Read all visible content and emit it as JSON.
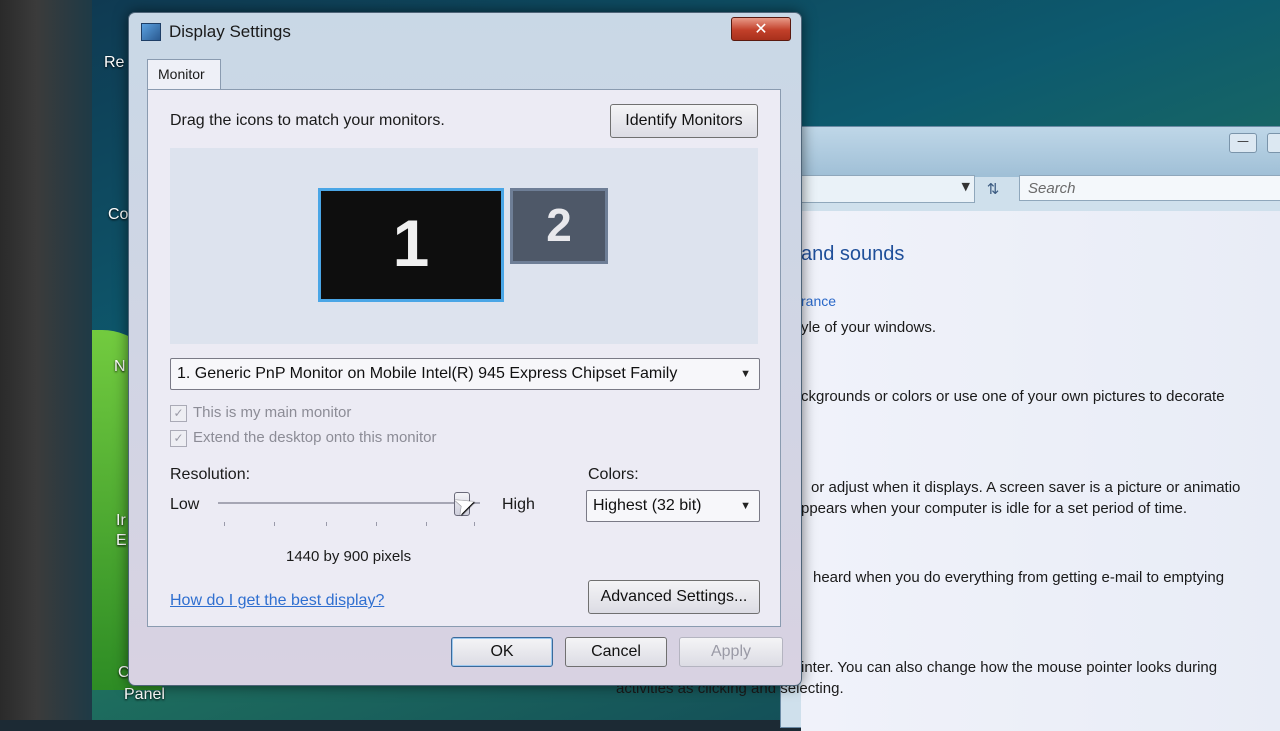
{
  "desktop": {
    "labels": [
      "Re",
      "Co",
      "N",
      "Ir",
      "E",
      "C",
      "Panel"
    ]
  },
  "background_window": {
    "search_placeholder": "Search",
    "heading": "and sounds",
    "link": "rance",
    "lines": [
      "yle of your windows.",
      "ckgrounds or colors or use one of your own pictures to decorate",
      "or adjust when it displays. A screen saver is a picture or animatio",
      "ppears when your computer is idle for a set period of time.",
      "heard when you do everything from getting e-mail to emptying",
      "inter. You can also change how the mouse pointer looks during",
      "activities as clicking and selecting."
    ],
    "minimize_label": "—"
  },
  "dialog": {
    "title": "Display Settings",
    "close_label": "✕",
    "tab": "Monitor",
    "instruction": "Drag the icons to match your monitors.",
    "identify_button": "Identify Monitors",
    "monitors": [
      {
        "label": "1",
        "selected": true
      },
      {
        "label": "2",
        "selected": false
      }
    ],
    "monitor_select": "1. Generic PnP Monitor on Mobile Intel(R) 945 Express Chipset Family",
    "main_monitor_checkbox": "This is my main monitor",
    "extend_checkbox": "Extend the desktop onto this monitor",
    "resolution_label": "Resolution:",
    "resolution_low": "Low",
    "resolution_high": "High",
    "resolution_slider_level": 0.95,
    "resolution_value": "1440 by 900 pixels",
    "colors_label": "Colors:",
    "colors_select": "Highest (32 bit)",
    "help_link": "How do I get the best display?",
    "advanced_button": "Advanced Settings...",
    "ok_button": "OK",
    "cancel_button": "Cancel",
    "apply_button": "Apply"
  }
}
